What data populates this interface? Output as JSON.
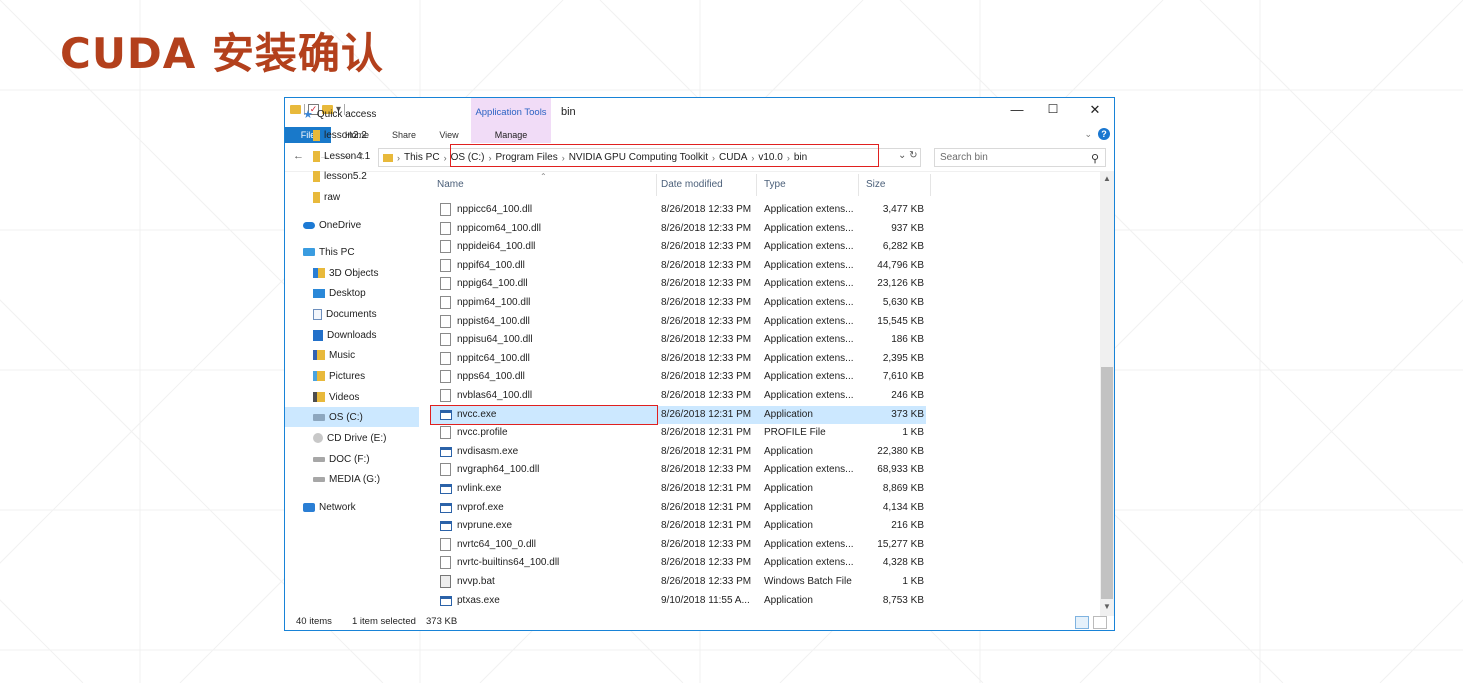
{
  "slide": {
    "title": "CUDA 安装确认"
  },
  "window": {
    "title": "bin",
    "contextual_tab": "Application Tools",
    "ribbon_tabs": [
      "File",
      "Home",
      "Share",
      "View",
      "Manage"
    ],
    "controls": {
      "minimize": "—",
      "maximize": "☐",
      "close": "✕"
    },
    "accent_color": "#1979ca"
  },
  "address": {
    "this_pc": "This PC",
    "crumbs": [
      "OS (C:)",
      "Program Files",
      "NVIDIA GPU Computing Toolkit",
      "CUDA",
      "v10.0",
      "bin"
    ],
    "search_placeholder": "Search bin"
  },
  "nav": [
    {
      "label": "Quick access",
      "icon": "star-icon"
    },
    {
      "label": "lesson2.2",
      "icon": "folder-icon"
    },
    {
      "label": "Lesson4.1",
      "icon": "folder-icon"
    },
    {
      "label": "lesson5.2",
      "icon": "folder-icon"
    },
    {
      "label": "raw",
      "icon": "folder-icon"
    },
    {
      "label": "OneDrive",
      "icon": "cloud-icon"
    },
    {
      "label": "This PC",
      "icon": "computer-icon"
    },
    {
      "label": "3D Objects",
      "icon": "3d-objects-icon"
    },
    {
      "label": "Desktop",
      "icon": "desktop-icon"
    },
    {
      "label": "Documents",
      "icon": "documents-icon"
    },
    {
      "label": "Downloads",
      "icon": "downloads-icon"
    },
    {
      "label": "Music",
      "icon": "music-icon"
    },
    {
      "label": "Pictures",
      "icon": "pictures-icon"
    },
    {
      "label": "Videos",
      "icon": "videos-icon"
    },
    {
      "label": "OS (C:)",
      "icon": "drive-icon"
    },
    {
      "label": "CD Drive (E:)",
      "icon": "cd-drive-icon"
    },
    {
      "label": "DOC (F:)",
      "icon": "disk-icon"
    },
    {
      "label": "MEDIA (G:)",
      "icon": "disk-icon"
    },
    {
      "label": "Network",
      "icon": "network-icon"
    }
  ],
  "columns": {
    "name": "Name",
    "date": "Date modified",
    "type": "Type",
    "size": "Size"
  },
  "files": [
    {
      "name": "nppicc64_100.dll",
      "date": "8/26/2018 12:33 PM",
      "type": "Application extens...",
      "size": "3,477 KB",
      "kind": "dll"
    },
    {
      "name": "nppicom64_100.dll",
      "date": "8/26/2018 12:33 PM",
      "type": "Application extens...",
      "size": "937 KB",
      "kind": "dll"
    },
    {
      "name": "nppidei64_100.dll",
      "date": "8/26/2018 12:33 PM",
      "type": "Application extens...",
      "size": "6,282 KB",
      "kind": "dll"
    },
    {
      "name": "nppif64_100.dll",
      "date": "8/26/2018 12:33 PM",
      "type": "Application extens...",
      "size": "44,796 KB",
      "kind": "dll"
    },
    {
      "name": "nppig64_100.dll",
      "date": "8/26/2018 12:33 PM",
      "type": "Application extens...",
      "size": "23,126 KB",
      "kind": "dll"
    },
    {
      "name": "nppim64_100.dll",
      "date": "8/26/2018 12:33 PM",
      "type": "Application extens...",
      "size": "5,630 KB",
      "kind": "dll"
    },
    {
      "name": "nppist64_100.dll",
      "date": "8/26/2018 12:33 PM",
      "type": "Application extens...",
      "size": "15,545 KB",
      "kind": "dll"
    },
    {
      "name": "nppisu64_100.dll",
      "date": "8/26/2018 12:33 PM",
      "type": "Application extens...",
      "size": "186 KB",
      "kind": "dll"
    },
    {
      "name": "nppitc64_100.dll",
      "date": "8/26/2018 12:33 PM",
      "type": "Application extens...",
      "size": "2,395 KB",
      "kind": "dll"
    },
    {
      "name": "npps64_100.dll",
      "date": "8/26/2018 12:33 PM",
      "type": "Application extens...",
      "size": "7,610 KB",
      "kind": "dll"
    },
    {
      "name": "nvblas64_100.dll",
      "date": "8/26/2018 12:33 PM",
      "type": "Application extens...",
      "size": "246 KB",
      "kind": "dll"
    },
    {
      "name": "nvcc.exe",
      "date": "8/26/2018 12:31 PM",
      "type": "Application",
      "size": "373 KB",
      "kind": "exe",
      "selected": true
    },
    {
      "name": "nvcc.profile",
      "date": "8/26/2018 12:31 PM",
      "type": "PROFILE File",
      "size": "1 KB",
      "kind": "file"
    },
    {
      "name": "nvdisasm.exe",
      "date": "8/26/2018 12:31 PM",
      "type": "Application",
      "size": "22,380 KB",
      "kind": "exe"
    },
    {
      "name": "nvgraph64_100.dll",
      "date": "8/26/2018 12:33 PM",
      "type": "Application extens...",
      "size": "68,933 KB",
      "kind": "dll"
    },
    {
      "name": "nvlink.exe",
      "date": "8/26/2018 12:31 PM",
      "type": "Application",
      "size": "8,869 KB",
      "kind": "exe"
    },
    {
      "name": "nvprof.exe",
      "date": "8/26/2018 12:31 PM",
      "type": "Application",
      "size": "4,134 KB",
      "kind": "exe"
    },
    {
      "name": "nvprune.exe",
      "date": "8/26/2018 12:31 PM",
      "type": "Application",
      "size": "216 KB",
      "kind": "exe"
    },
    {
      "name": "nvrtc64_100_0.dll",
      "date": "8/26/2018 12:33 PM",
      "type": "Application extens...",
      "size": "15,277 KB",
      "kind": "dll"
    },
    {
      "name": "nvrtc-builtins64_100.dll",
      "date": "8/26/2018 12:33 PM",
      "type": "Application extens...",
      "size": "4,328 KB",
      "kind": "dll"
    },
    {
      "name": "nvvp.bat",
      "date": "8/26/2018 12:33 PM",
      "type": "Windows Batch File",
      "size": "1 KB",
      "kind": "bat"
    },
    {
      "name": "ptxas.exe",
      "date": "9/10/2018 11:55 A...",
      "type": "Application",
      "size": "8,753 KB",
      "kind": "exe"
    }
  ],
  "status": {
    "items": "40 items",
    "selected": "1 item selected",
    "selected_size": "373 KB"
  }
}
